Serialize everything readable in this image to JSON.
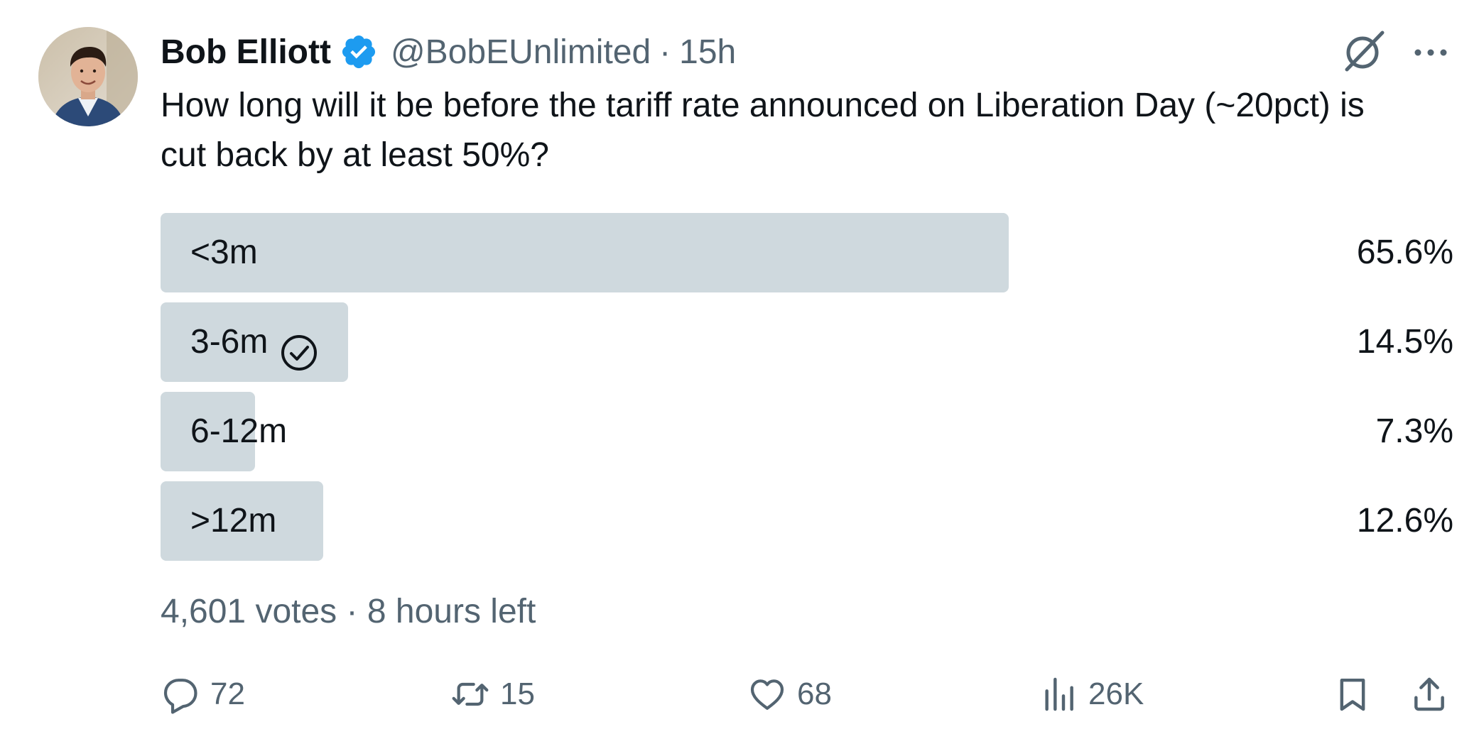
{
  "author": {
    "name": "Bob Elliott",
    "handle": "@BobEUnlimited",
    "separator": "·",
    "time": "15h",
    "verified_color": "#1d9bf0"
  },
  "tweet": {
    "text": "How long will it be before the tariff rate announced on Liberation Day (~20pct) is cut back by at least 50%?"
  },
  "poll": {
    "options": [
      {
        "label": "<3m",
        "percent_text": "65.6%",
        "fraction": 0.656,
        "selected": false
      },
      {
        "label": "3-6m",
        "percent_text": "14.5%",
        "fraction": 0.145,
        "selected": true
      },
      {
        "label": "6-12m",
        "percent_text": "7.3%",
        "fraction": 0.073,
        "selected": false
      },
      {
        "label": ">12m",
        "percent_text": "12.6%",
        "fraction": 0.126,
        "selected": false
      }
    ],
    "summary": "4,601 votes · 8 hours left",
    "bar_color": "#cfd9de"
  },
  "actions": {
    "replies": "72",
    "reposts": "15",
    "likes": "68",
    "views": "26K"
  },
  "icons": {
    "grok": "grok-icon",
    "more": "more-icon",
    "reply": "reply-icon",
    "repost": "repost-icon",
    "like": "heart-icon",
    "views": "views-icon",
    "bookmark": "bookmark-icon",
    "share": "share-icon"
  },
  "colors": {
    "text": "#0f1419",
    "secondary": "#536471"
  }
}
